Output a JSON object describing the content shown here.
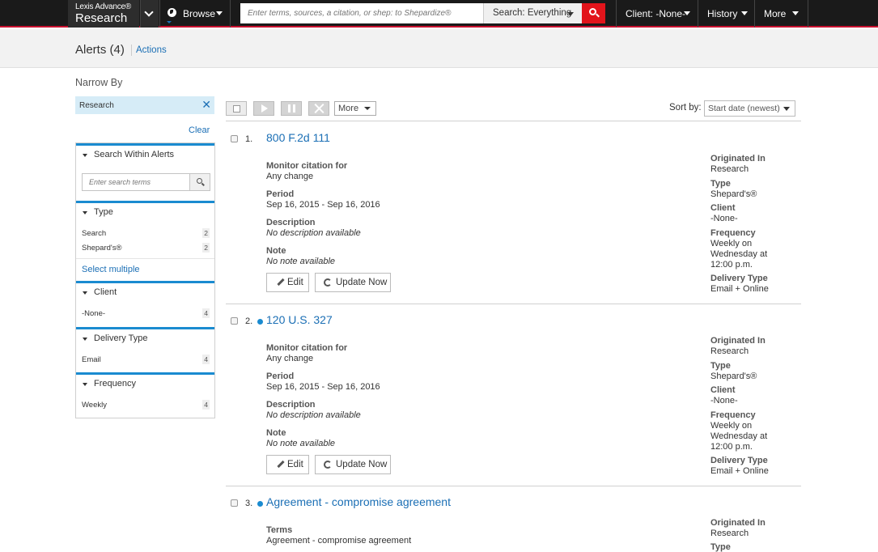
{
  "topbar": {
    "logo_line1": "Lexis Advance®",
    "logo_line2": "Research",
    "browse_label": "Browse",
    "search_placeholder": "Enter terms, sources, a citation, or shep: to Shepardize®",
    "search_scope": "Search: Everything",
    "client_label": "Client: -None-",
    "history_label": "History",
    "more_label": "More"
  },
  "header": {
    "title": "Alerts (4)",
    "actions_label": "Actions"
  },
  "sidebar": {
    "narrow_by": "Narrow By",
    "active_filter": "Research",
    "clear_label": "Clear",
    "search_within": {
      "heading": "Search Within Alerts",
      "placeholder": "Enter search terms"
    },
    "type": {
      "heading": "Type",
      "items": [
        {
          "label": "Search",
          "count": "2"
        },
        {
          "label": "Shepard's®",
          "count": "2"
        }
      ],
      "select_multiple": "Select multiple"
    },
    "client": {
      "heading": "Client",
      "items": [
        {
          "label": "-None-",
          "count": "4"
        }
      ]
    },
    "delivery_type": {
      "heading": "Delivery Type",
      "items": [
        {
          "label": "Email",
          "count": "4"
        }
      ]
    },
    "frequency": {
      "heading": "Frequency",
      "items": [
        {
          "label": "Weekly",
          "count": "4"
        }
      ]
    }
  },
  "toolbar": {
    "more_label": "More",
    "sort_label": "Sort by:",
    "sort_value": "Start date (newest)"
  },
  "results": [
    {
      "number": "1.",
      "title": "800 F.2d 111",
      "monitor_label": "Monitor citation for",
      "monitor_value": "Any change",
      "period_label": "Period",
      "period_value": "Sep 16, 2015 - Sep 16, 2016",
      "description_label": "Description",
      "description_value": "No description available",
      "note_label": "Note",
      "note_value": "No note available",
      "edit_label": "Edit",
      "update_label": "Update Now",
      "originated_label": "Originated In",
      "originated_value": "Research",
      "type_label": "Type",
      "type_value": "Shepard's®",
      "client_label": "Client",
      "client_value": "-None-",
      "frequency_label": "Frequency",
      "frequency_line1": "Weekly on",
      "frequency_line2": "Wednesday at",
      "frequency_line3": "12:00 p.m.",
      "delivery_label": "Delivery Type",
      "delivery_value": "Email + Online"
    },
    {
      "number": "2.",
      "title": "120 U.S. 327",
      "monitor_label": "Monitor citation for",
      "monitor_value": "Any change",
      "period_label": "Period",
      "period_value": "Sep 16, 2015 - Sep 16, 2016",
      "description_label": "Description",
      "description_value": "No description available",
      "note_label": "Note",
      "note_value": "No note available",
      "edit_label": "Edit",
      "update_label": "Update Now",
      "originated_label": "Originated In",
      "originated_value": "Research",
      "type_label": "Type",
      "type_value": "Shepard's®",
      "client_label": "Client",
      "client_value": "-None-",
      "frequency_label": "Frequency",
      "frequency_line1": "Weekly on",
      "frequency_line2": "Wednesday at",
      "frequency_line3": "12:00 p.m.",
      "delivery_label": "Delivery Type",
      "delivery_value": "Email + Online"
    },
    {
      "number": "3.",
      "title": "Agreement  - compromise agreement",
      "terms_label": "Terms",
      "terms_value": "Agreement  - compromise agreement",
      "originated_label": "Originated In",
      "originated_value": "Research",
      "type_label": "Type"
    }
  ],
  "colors": {
    "topbar_bg": "#1a1a1a",
    "accent_red": "#e2141b",
    "link_blue": "#1b6fb5",
    "facet_border_blue": "#1a8bd0",
    "chip_bg": "#d6ecf7"
  }
}
